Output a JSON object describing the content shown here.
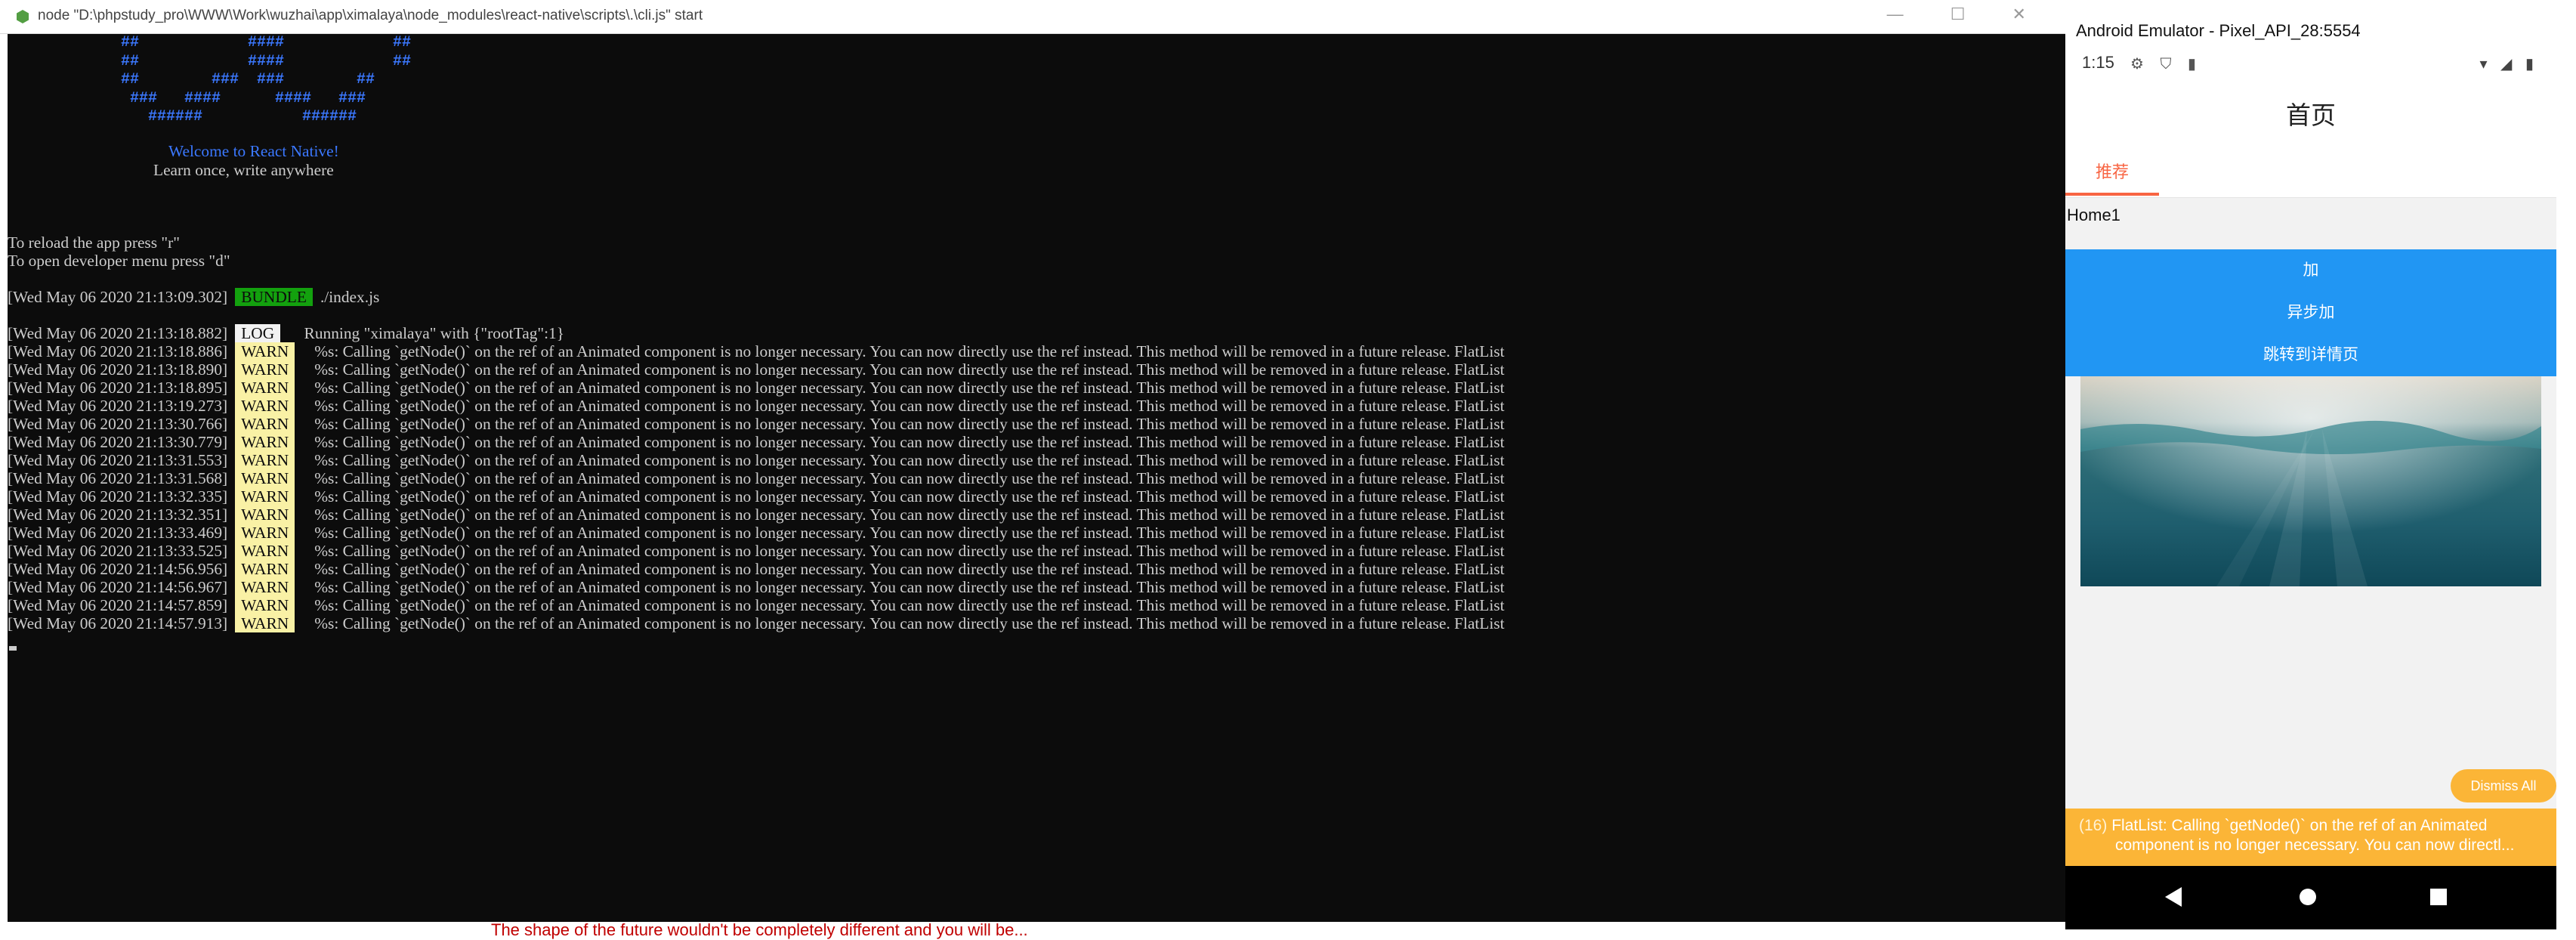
{
  "terminal": {
    "window_title": "node \"D:\\phpstudy_pro\\WWW\\Work\\wuzhai\\app\\ximalaya\\node_modules\\react-native\\scripts\\.\\cli.js\" start",
    "ascii_art": [
      "##            ####            ##",
      "##            ####            ##",
      "##        ###  ###        ##",
      " ###   ####      ####   ###",
      "   ######           ######"
    ],
    "welcome": "Welcome to React Native!",
    "tagline": "Learn once, write anywhere",
    "hint_reload": "To reload the app press \"r\"",
    "hint_menu": "To open developer menu press \"d\"",
    "bundle": {
      "timestamp": "[Wed May 06 2020 21:13:09.302]",
      "badge": "BUNDLE",
      "text": "./index.js"
    },
    "logs": [
      {
        "timestamp": "[Wed May 06 2020 21:13:18.882]",
        "level": "LOG",
        "message": "Running \"ximalaya\" with {\"rootTag\":1}"
      },
      {
        "timestamp": "[Wed May 06 2020 21:13:18.886]",
        "level": "WARN",
        "message": "%s: Calling `getNode()` on the ref of an Animated component is no longer necessary. You can now directly use the ref instead. This method will be removed in a future release. FlatList"
      },
      {
        "timestamp": "[Wed May 06 2020 21:13:18.890]",
        "level": "WARN",
        "message": "%s: Calling `getNode()` on the ref of an Animated component is no longer necessary. You can now directly use the ref instead. This method will be removed in a future release. FlatList"
      },
      {
        "timestamp": "[Wed May 06 2020 21:13:18.895]",
        "level": "WARN",
        "message": "%s: Calling `getNode()` on the ref of an Animated component is no longer necessary. You can now directly use the ref instead. This method will be removed in a future release. FlatList"
      },
      {
        "timestamp": "[Wed May 06 2020 21:13:19.273]",
        "level": "WARN",
        "message": "%s: Calling `getNode()` on the ref of an Animated component is no longer necessary. You can now directly use the ref instead. This method will be removed in a future release. FlatList"
      },
      {
        "timestamp": "[Wed May 06 2020 21:13:30.766]",
        "level": "WARN",
        "message": "%s: Calling `getNode()` on the ref of an Animated component is no longer necessary. You can now directly use the ref instead. This method will be removed in a future release. FlatList"
      },
      {
        "timestamp": "[Wed May 06 2020 21:13:30.779]",
        "level": "WARN",
        "message": "%s: Calling `getNode()` on the ref of an Animated component is no longer necessary. You can now directly use the ref instead. This method will be removed in a future release. FlatList"
      },
      {
        "timestamp": "[Wed May 06 2020 21:13:31.553]",
        "level": "WARN",
        "message": "%s: Calling `getNode()` on the ref of an Animated component is no longer necessary. You can now directly use the ref instead. This method will be removed in a future release. FlatList"
      },
      {
        "timestamp": "[Wed May 06 2020 21:13:31.568]",
        "level": "WARN",
        "message": "%s: Calling `getNode()` on the ref of an Animated component is no longer necessary. You can now directly use the ref instead. This method will be removed in a future release. FlatList"
      },
      {
        "timestamp": "[Wed May 06 2020 21:13:32.335]",
        "level": "WARN",
        "message": "%s: Calling `getNode()` on the ref of an Animated component is no longer necessary. You can now directly use the ref instead. This method will be removed in a future release. FlatList"
      },
      {
        "timestamp": "[Wed May 06 2020 21:13:32.351]",
        "level": "WARN",
        "message": "%s: Calling `getNode()` on the ref of an Animated component is no longer necessary. You can now directly use the ref instead. This method will be removed in a future release. FlatList"
      },
      {
        "timestamp": "[Wed May 06 2020 21:13:33.469]",
        "level": "WARN",
        "message": "%s: Calling `getNode()` on the ref of an Animated component is no longer necessary. You can now directly use the ref instead. This method will be removed in a future release. FlatList"
      },
      {
        "timestamp": "[Wed May 06 2020 21:13:33.525]",
        "level": "WARN",
        "message": "%s: Calling `getNode()` on the ref of an Animated component is no longer necessary. You can now directly use the ref instead. This method will be removed in a future release. FlatList"
      },
      {
        "timestamp": "[Wed May 06 2020 21:14:56.956]",
        "level": "WARN",
        "message": "%s: Calling `getNode()` on the ref of an Animated component is no longer necessary. You can now directly use the ref instead. This method will be removed in a future release. FlatList"
      },
      {
        "timestamp": "[Wed May 06 2020 21:14:56.967]",
        "level": "WARN",
        "message": "%s: Calling `getNode()` on the ref of an Animated component is no longer necessary. You can now directly use the ref instead. This method will be removed in a future release. FlatList"
      },
      {
        "timestamp": "[Wed May 06 2020 21:14:57.859]",
        "level": "WARN",
        "message": "%s: Calling `getNode()` on the ref of an Animated component is no longer necessary. You can now directly use the ref instead. This method will be removed in a future release. FlatList"
      },
      {
        "timestamp": "[Wed May 06 2020 21:14:57.913]",
        "level": "WARN",
        "message": "%s: Calling `getNode()` on the ref of an Animated component is no longer necessary. You can now directly use the ref instead. This method will be removed in a future release. FlatList"
      }
    ],
    "background_text": "The shape of the future wouldn't be completely different and you will be..."
  },
  "emulator": {
    "window_title": "Android Emulator - Pixel_API_28:5554",
    "status": {
      "time": "1:15",
      "icons_left": "⚙ ⛉ ▮",
      "icons_right": "▾ ◢ ▮"
    },
    "header_title": "首页",
    "tabs": [
      {
        "label": "推荐",
        "active": true
      }
    ],
    "home_label": "Home1",
    "buttons": {
      "add": "加",
      "async_add": "异步加",
      "detail": "跳转到详情页"
    },
    "dismiss_all": "Dismiss All",
    "toast": {
      "count": "(16)",
      "line1": "FlatList: Calling `getNode()` on the ref of an Animated",
      "line2": "component is no longer necessary. You can now directl..."
    }
  },
  "colors": {
    "terminal_bg": "#0c0c0c",
    "terminal_text": "#cccccc",
    "react_blue": "#3b78ff",
    "bundle_green": "#13a10e",
    "warn_yellow": "#f9f1a5",
    "tab_accent": "#f86442",
    "button_blue": "#2196f3",
    "toast_amber": "#fbb537"
  }
}
